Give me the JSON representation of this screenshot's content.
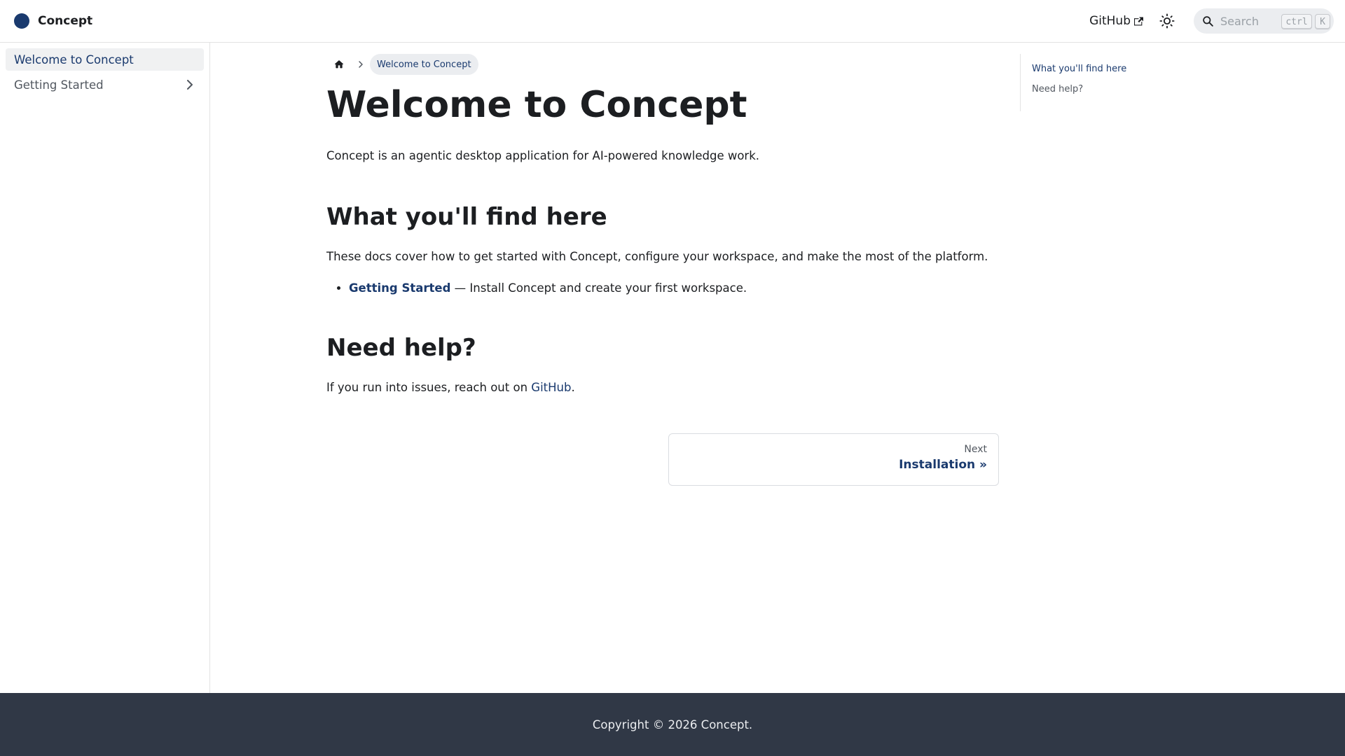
{
  "navbar": {
    "brand": "Concept",
    "github_label": "GitHub",
    "search_placeholder": "Search",
    "kbd_ctrl": "ctrl",
    "kbd_k": "K"
  },
  "sidebar": {
    "items": [
      {
        "label": "Welcome to Concept",
        "active": true
      },
      {
        "label": "Getting Started",
        "expandable": true
      }
    ]
  },
  "breadcrumb": {
    "current": "Welcome to Concept"
  },
  "main": {
    "title": "Welcome to Concept",
    "intro": "Concept is an agentic desktop application for AI-powered knowledge work.",
    "section1": {
      "heading": "What you'll find here",
      "body": "These docs cover how to get started with Concept, configure your workspace, and make the most of the platform.",
      "list": [
        {
          "link": "Getting Started",
          "text": " — Install Concept and create your first workspace."
        }
      ]
    },
    "section2": {
      "heading": "Need help?",
      "body_prefix": "If you run into issues, reach out on ",
      "link": "GitHub",
      "body_suffix": "."
    },
    "pager": {
      "sublabel": "Next",
      "label": "Installation »"
    }
  },
  "toc": {
    "items": [
      "What you'll find here",
      "Need help?"
    ]
  },
  "footer": {
    "copyright": "Copyright © 2026 Concept."
  },
  "colors": {
    "accent": "#1a3a6e",
    "footer_bg": "#303846"
  }
}
